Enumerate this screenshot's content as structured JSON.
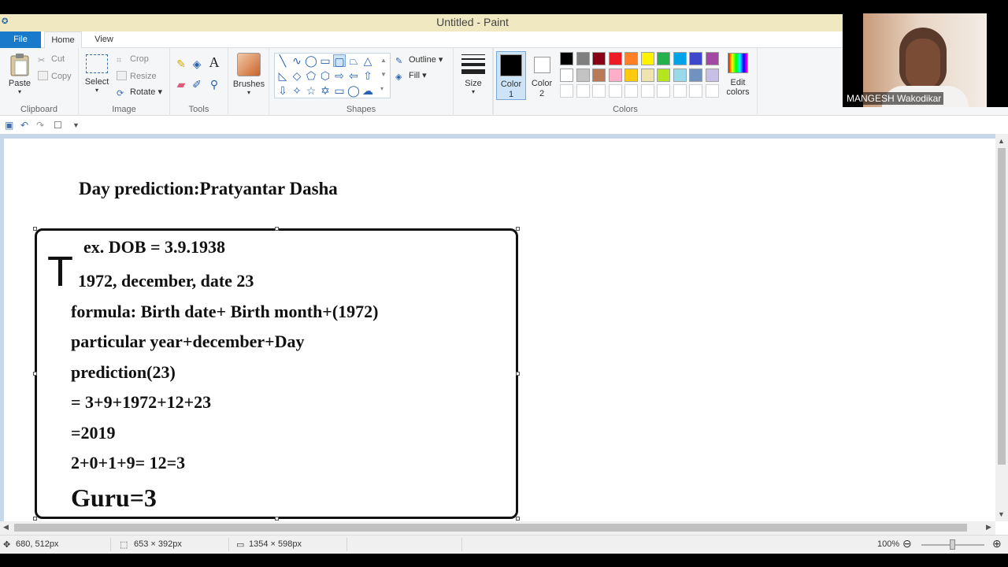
{
  "window": {
    "title": "Untitled - Paint"
  },
  "tabs": {
    "file": "File",
    "home": "Home",
    "view": "View"
  },
  "ribbon": {
    "clipboard": {
      "label": "Clipboard",
      "paste": "Paste",
      "cut": "Cut",
      "copy": "Copy"
    },
    "image": {
      "label": "Image",
      "select": "Select",
      "crop": "Crop",
      "resize": "Resize",
      "rotate": "Rotate"
    },
    "tools": {
      "label": "Tools"
    },
    "brushes": {
      "label": "Brushes"
    },
    "shapes": {
      "label": "Shapes",
      "outline": "Outline",
      "fill": "Fill"
    },
    "size": {
      "label": "Size"
    },
    "color1": {
      "label_line1": "Color",
      "label_line2": "1"
    },
    "color2": {
      "label_line1": "Color",
      "label_line2": "2"
    },
    "colors": {
      "label": "Colors",
      "edit_line1": "Edit",
      "edit_line2": "colors",
      "row1": [
        "#000000",
        "#7f7f7f",
        "#880015",
        "#ed1c24",
        "#ff7f27",
        "#fff200",
        "#22b14c",
        "#00a2e8",
        "#3f48cc",
        "#a349a4"
      ],
      "row2": [
        "#ffffff",
        "#c3c3c3",
        "#b97a57",
        "#ffaec9",
        "#ffc90e",
        "#efe4b0",
        "#b5e61d",
        "#99d9ea",
        "#7092be",
        "#c8bfe7"
      ]
    }
  },
  "canvas": {
    "heading": "Day prediction:Pratyantar Dasha",
    "lines": [
      "ex. DOB = 3.9.1938",
      "1972, december, date 23",
      "formula: Birth date+ Birth month+(1972)",
      "particular year+december+Day",
      "prediction(23)",
      "= 3+9+1972+12+23",
      "=2019",
      "2+0+1+9= 12=3",
      "Guru=3"
    ]
  },
  "status": {
    "cursor_position": "680, 512px",
    "selection_size": "653 × 392px",
    "image_size": "1354 × 598px",
    "zoom": "100%"
  },
  "webcam": {
    "name": "MANGESH Wakodikar"
  }
}
